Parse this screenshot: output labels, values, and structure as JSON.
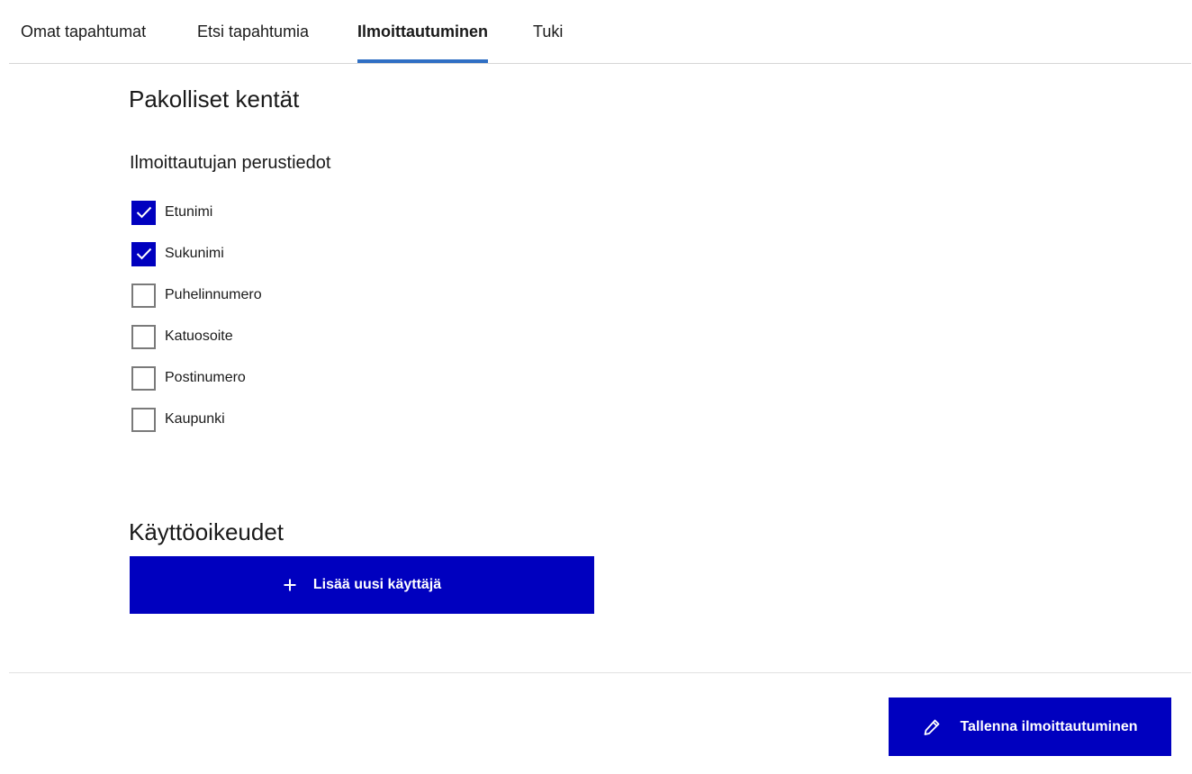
{
  "tabs": [
    {
      "label": "Omat tapahtumat",
      "active": false
    },
    {
      "label": "Etsi tapahtumia",
      "active": false
    },
    {
      "label": "Ilmoittautuminen",
      "active": true
    },
    {
      "label": "Tuki",
      "active": false
    }
  ],
  "required_fields": {
    "heading": "Pakolliset kentät",
    "subheading": "Ilmoittautujan perustiedot",
    "fields": [
      {
        "label": "Etunimi",
        "checked": true
      },
      {
        "label": "Sukunimi",
        "checked": true
      },
      {
        "label": "Puhelinnumero",
        "checked": false
      },
      {
        "label": "Katuosoite",
        "checked": false
      },
      {
        "label": "Postinumero",
        "checked": false
      },
      {
        "label": "Kaupunki",
        "checked": false
      }
    ]
  },
  "access": {
    "heading": "Käyttöoikeudet",
    "add_user_label": "Lisää uusi käyttäjä",
    "add_icon": "plus-icon"
  },
  "footer": {
    "save_label": "Tallenna ilmoittautuminen",
    "save_icon": "pencil-icon"
  },
  "colors": {
    "primary": "#0000bf",
    "tab_indicator": "#2f6fc4",
    "checkbox_border": "#7a7a7a",
    "divider": "#d6d6d6"
  }
}
